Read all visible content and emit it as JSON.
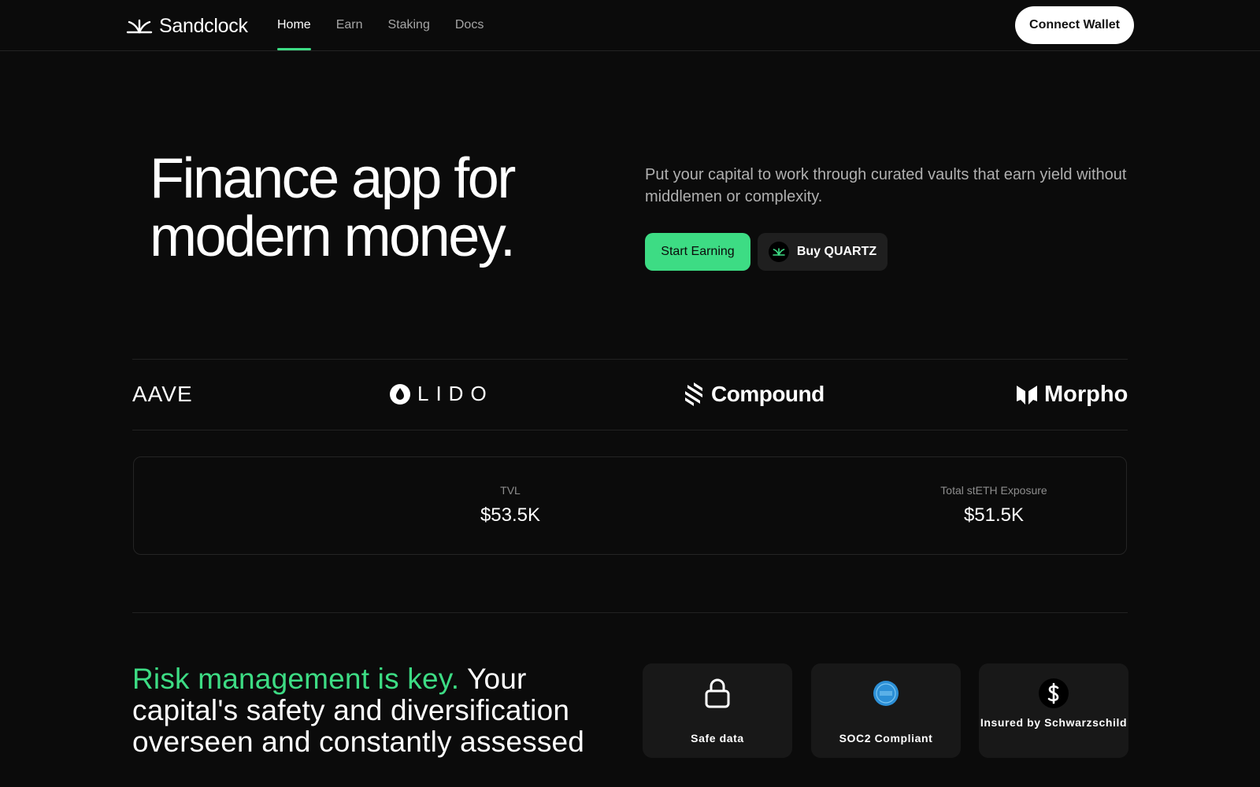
{
  "header": {
    "brand": "Sandclock",
    "nav": [
      {
        "label": "Home",
        "active": true
      },
      {
        "label": "Earn",
        "active": false
      },
      {
        "label": "Staking",
        "active": false
      },
      {
        "label": "Docs",
        "active": false
      }
    ],
    "connect_label": "Connect Wallet"
  },
  "hero": {
    "title_line1": "Finance app for",
    "title_line2": "modern money.",
    "subtitle": "Put your capital to work through curated vaults that earn yield without middlemen or complexity.",
    "start_label": "Start Earning",
    "buy_label": "Buy QUARTZ"
  },
  "partners": {
    "aave": "AAVE",
    "lido": "LIDO",
    "compound": "Compound",
    "morpho": "Morpho"
  },
  "stats": {
    "tvl_label": "TVL",
    "tvl_value": "$53.5K",
    "steth_label": "Total stETH Exposure",
    "steth_value": "$51.5K"
  },
  "risk": {
    "accent": "Risk management is key.",
    "rest": " Your capital's safety and diversification overseen and constantly assessed",
    "cards": [
      {
        "label": "Safe data",
        "icon": "lock-icon"
      },
      {
        "label": "SOC2 Compliant",
        "icon": "aicpa-soc-badge-icon"
      },
      {
        "label": "Insured by Schwarzschild",
        "icon": "dollar-circle-icon"
      }
    ]
  },
  "colors": {
    "accent": "#3ddc84",
    "background": "#0b0b0b",
    "card": "#181818"
  }
}
